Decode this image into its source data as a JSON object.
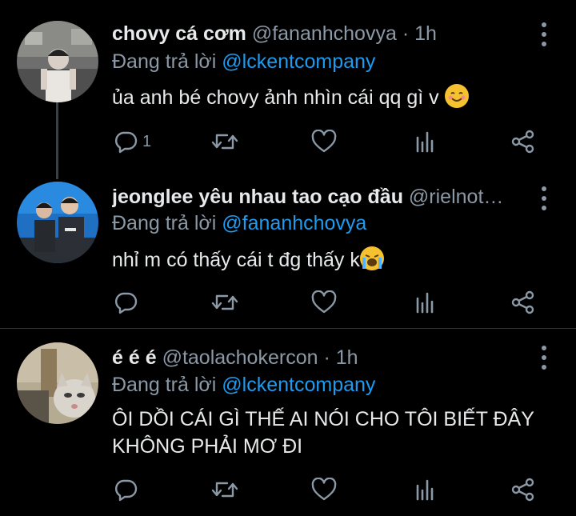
{
  "tweets": [
    {
      "name": "chovy cá cơm",
      "handle": "@fananhchovya",
      "time": "· 1h",
      "reply_prefix": "Đang trả lời ",
      "reply_to": "@lckentcompany",
      "text": "ủa anh bé chovy ảnh nhìn cái qq gì v",
      "emoji": "smiling-face-emoji",
      "reply_count": "1",
      "retweet_count": "",
      "like_count": ""
    },
    {
      "name": "jeonglee yêu nhau tao cạo đầu",
      "handle": "@rielnot…",
      "time": "",
      "reply_prefix": "Đang trả lời ",
      "reply_to": "@fananhchovya",
      "text": "nhỉ m có thấy cái t đg thấy k",
      "emoji": "crying-face-emoji",
      "reply_count": "",
      "retweet_count": "",
      "like_count": ""
    },
    {
      "name": "é é é",
      "handle": "@taolachokercon",
      "time": "· 1h",
      "reply_prefix": "Đang trả lời ",
      "reply_to": "@lckentcompany",
      "text_line1": "ÔI DỒI CÁI GÌ THẾ AI NÓI CHO TÔI BIẾT ĐÂY",
      "text_line2": "KHÔNG PHẢI MƠ ĐI",
      "reply_count": "",
      "retweet_count": "",
      "like_count": ""
    }
  ],
  "colors": {
    "background": "#000000",
    "text": "#e7e9ea",
    "secondary": "#8b98a5",
    "mention": "#1d9bf0",
    "divider": "#2f3336"
  },
  "icons": [
    "reply-icon",
    "retweet-icon",
    "like-icon",
    "analytics-icon",
    "share-icon",
    "more-icon"
  ]
}
